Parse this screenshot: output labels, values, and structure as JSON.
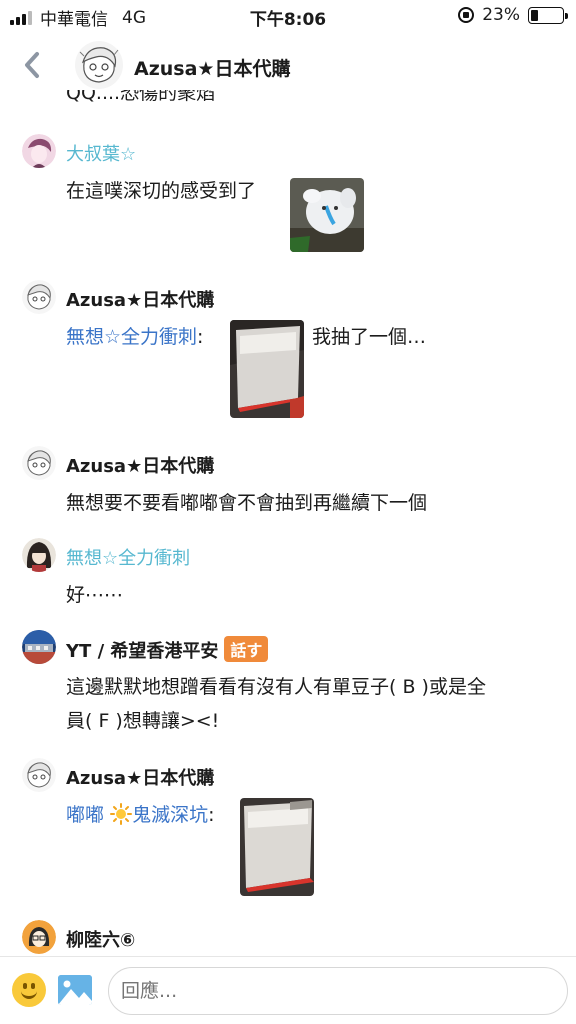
{
  "status_bar": {
    "carrier": "中華電信",
    "network": "4G",
    "time": "下午8:06",
    "battery": "23%",
    "battery_level": 0.23
  },
  "header": {
    "title": "Azusa★日本代購",
    "back_icon": "chevron-left-icon"
  },
  "chat": {
    "cut_off_text": "QQ....恐傷的聚焰",
    "messages": [
      {
        "name": "大叔葉☆",
        "text": "在這噗深切的感受到了"
      },
      {
        "name": "Azusa★日本代購",
        "mention": "無想☆全力衝刺",
        "colon": ":",
        "text": "我抽了一個…"
      },
      {
        "name": "Azusa★日本代購",
        "text": "無想要不要看嘟嘟會不會抽到再繼續下一個"
      },
      {
        "name": "無想☆全力衝刺",
        "text": "好⋯⋯"
      },
      {
        "name": "YT / 希望香港平安",
        "badge": "話す",
        "text_line1": "這邊默默地想蹭看看有沒有人有單豆子( B )或是全",
        "text_line2": "員( F )想轉讓><!"
      },
      {
        "name": "Azusa★日本代購",
        "mention_a": "嘟嘟",
        "mention_b": "鬼滅深坑",
        "colon": ":"
      },
      {
        "name": "柳陸六⑥"
      }
    ]
  },
  "input": {
    "placeholder": "回應..."
  },
  "colors": {
    "name_teal": "#57b8d0",
    "mention_blue": "#3a74c8",
    "badge_orange": "#f08a3a"
  }
}
